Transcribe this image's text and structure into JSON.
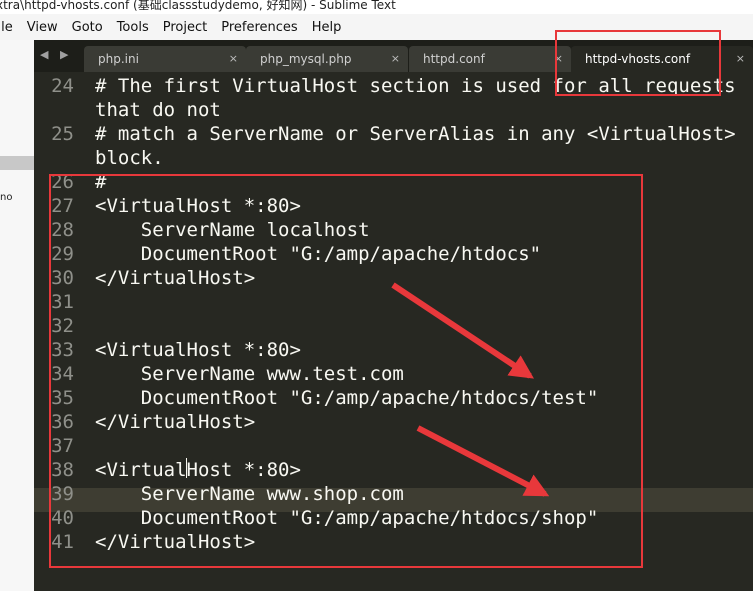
{
  "window": {
    "title": "xtra\\httpd-vhosts.conf (基础classstudydemo, 好知网) - Sublime Text"
  },
  "menu": [
    "File",
    "View",
    "Goto",
    "Tools",
    "Project",
    "Preferences",
    "Help"
  ],
  "left_pane": {
    "label": "no"
  },
  "tabs": [
    {
      "label": "php.ini",
      "close": "×"
    },
    {
      "label": "php_mysql.php",
      "close": "×"
    },
    {
      "label": "httpd.conf",
      "close": "×"
    },
    {
      "label": "httpd-vhosts.conf",
      "close": "×"
    }
  ],
  "nav_arrows": "◀ ▶",
  "code_lines": [
    {
      "num": "24",
      "text": "# The first VirtualHost section is used for all requests"
    },
    {
      "num": "",
      "text": "that do not"
    },
    {
      "num": "25",
      "text": "# match a ServerName or ServerAlias in any <VirtualHost>"
    },
    {
      "num": "",
      "text": "block."
    },
    {
      "num": "26",
      "text": "#"
    },
    {
      "num": "27",
      "text": "<VirtualHost *:80>"
    },
    {
      "num": "28",
      "text": "    ServerName localhost"
    },
    {
      "num": "29",
      "text": "    DocumentRoot \"G:/amp/apache/htdocs\""
    },
    {
      "num": "30",
      "text": "</VirtualHost>"
    },
    {
      "num": "31",
      "text": ""
    },
    {
      "num": "32",
      "text": ""
    },
    {
      "num": "33",
      "text": "<VirtualHost *:80>"
    },
    {
      "num": "34",
      "text": "    ServerName www.test.com"
    },
    {
      "num": "35",
      "text": "    DocumentRoot \"G:/amp/apache/htdocs/test\""
    },
    {
      "num": "36",
      "text": "</VirtualHost>"
    },
    {
      "num": "37",
      "text": ""
    },
    {
      "num": "38",
      "text": "<VirtualHost *:80>"
    },
    {
      "num": "39",
      "text": "    ServerName www.shop.com"
    },
    {
      "num": "40",
      "text": "    DocumentRoot \"G:/amp/apache/htdocs/shop\""
    },
    {
      "num": "41",
      "text": "</VirtualHost>"
    }
  ],
  "colors": {
    "editor_bg": "#272822",
    "annotation_red": "#e8383b",
    "line_number": "#8f908a"
  }
}
